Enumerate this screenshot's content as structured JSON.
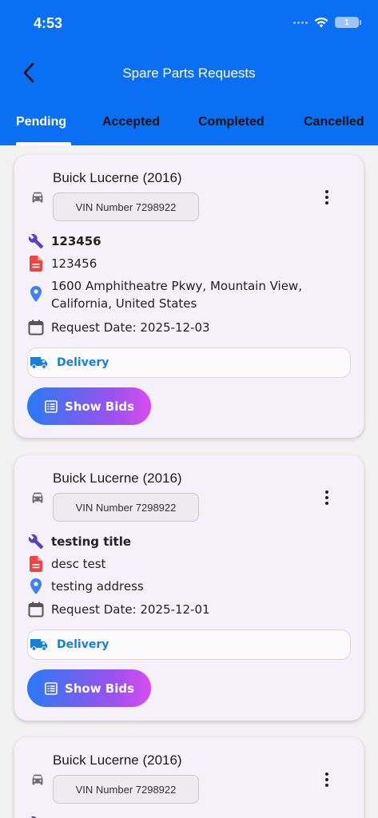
{
  "status_bar": {
    "time": "4:53",
    "battery": "1"
  },
  "header": {
    "title": "Spare Parts Requests"
  },
  "tabs": [
    {
      "label": "Pending",
      "active": true
    },
    {
      "label": "Accepted",
      "active": false
    },
    {
      "label": "Completed",
      "active": false
    },
    {
      "label": "Cancelled",
      "active": false
    }
  ],
  "colors": {
    "header_bg": "#0a6ff2",
    "card_bg": "#f5f1f8",
    "delivery_text": "#1a7fd8",
    "wrench_icon": "#5b3fc4",
    "doc_icon": "#ef4444",
    "pin_icon": "#3b82f6",
    "truck_icon": "#1a7fd8"
  },
  "requests": [
    {
      "vehicle": "Buick Lucerne (2016)",
      "vin": "VIN Number 7298922",
      "title": "123456",
      "description": "123456",
      "address": "1600 Amphitheatre Pkwy, Mountain View, California, United States",
      "request_date": "Request Date: 2025-12-03",
      "delivery": "Delivery",
      "bids_label": "Show Bids"
    },
    {
      "vehicle": "Buick Lucerne (2016)",
      "vin": "VIN Number 7298922",
      "title": "testing title",
      "description": "desc test",
      "address": "testing address",
      "request_date": "Request Date: 2025-12-01",
      "delivery": "Delivery",
      "bids_label": "Show Bids"
    },
    {
      "vehicle": "Buick Lucerne (2016)",
      "vin": "VIN Number 7298922"
    }
  ]
}
